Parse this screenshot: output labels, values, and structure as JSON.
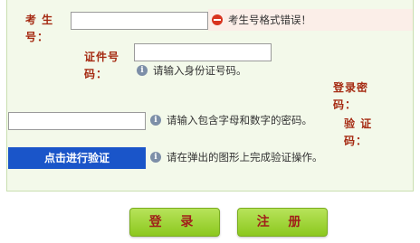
{
  "labels": {
    "candidate_no": "考 生\n号：",
    "id_no": "证件号\n码：",
    "password": "登录密\n码：",
    "captcha": "验 证\n码："
  },
  "error": {
    "text": "考生号格式错误！",
    "color": "#d8331e"
  },
  "hints": {
    "id_no": "请输入身份证号码。",
    "password": "请输入包含字母和数字的密码。",
    "captcha": "请在弹出的图形上完成验证操作。"
  },
  "verify_button": {
    "label": "点击进行验证",
    "color": "#1a55c9"
  },
  "buttons": {
    "login": "登 录",
    "register": "注 册",
    "color": "#8cc81e"
  },
  "inputs": {
    "candidate_no": "",
    "id_no": "",
    "password": ""
  },
  "icons": {
    "error": "error-minus-icon",
    "info": "info-icon"
  }
}
